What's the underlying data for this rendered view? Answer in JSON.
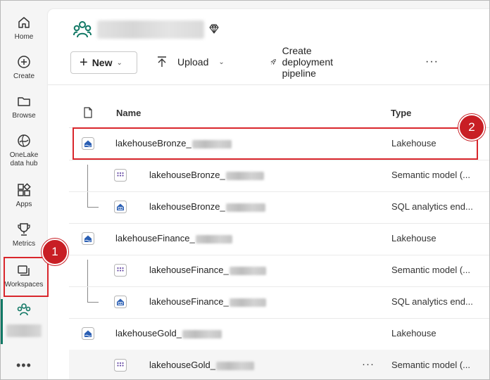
{
  "rail": {
    "items": [
      {
        "label": "Home",
        "icon": "home-icon"
      },
      {
        "label": "Create",
        "icon": "plus-circle-icon"
      },
      {
        "label": "Browse",
        "icon": "folder-icon"
      },
      {
        "label": "OneLake",
        "label2": "data hub",
        "icon": "onelake-icon"
      },
      {
        "label": "Apps",
        "icon": "apps-icon"
      },
      {
        "label": "Metrics",
        "icon": "trophy-icon"
      },
      {
        "label": "Workspaces",
        "icon": "workspaces-icon"
      }
    ],
    "more": "•••"
  },
  "toolbar": {
    "new_label": "New",
    "upload_label": "Upload",
    "deploy_label": "Create deployment pipeline",
    "more": "···"
  },
  "table": {
    "headers": {
      "name": "Name",
      "type": "Type"
    },
    "rows": [
      {
        "name": "lakehouseBronze_",
        "type": "Lakehouse",
        "icon": "lakehouse-icon"
      },
      {
        "name": "lakehouseBronze_",
        "type": "Semantic model (...",
        "icon": "semantic-model-icon"
      },
      {
        "name": "lakehouseBronze_",
        "type": "SQL analytics end...",
        "icon": "sql-endpoint-icon"
      },
      {
        "name": "lakehouseFinance_",
        "type": "Lakehouse",
        "icon": "lakehouse-icon"
      },
      {
        "name": "lakehouseFinance_",
        "type": "Semantic model (...",
        "icon": "semantic-model-icon"
      },
      {
        "name": "lakehouseFinance_",
        "type": "SQL analytics end...",
        "icon": "sql-endpoint-icon"
      },
      {
        "name": "lakehouseGold_",
        "type": "Lakehouse",
        "icon": "lakehouse-icon"
      },
      {
        "name": "lakehouseGold_",
        "type": "Semantic model (...",
        "icon": "semantic-model-icon"
      }
    ],
    "row_more": "···"
  },
  "annotations": {
    "badge1": "1",
    "badge2": "2"
  },
  "colors": {
    "accent": "#117865",
    "annotation": "#d9262c",
    "item_blue": "#2b5fb4"
  }
}
